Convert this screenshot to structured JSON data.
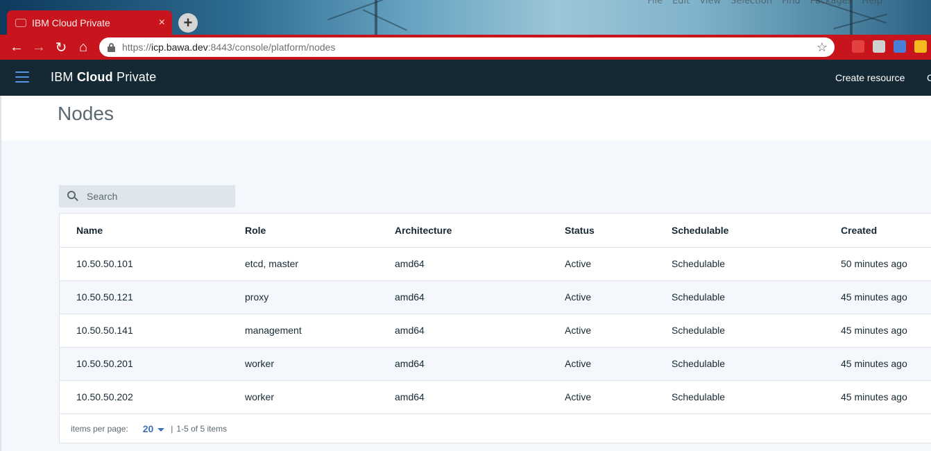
{
  "browser": {
    "desktop_menu": [
      "File",
      "Edit",
      "View",
      "Selection",
      "Find",
      "Packages",
      "Help"
    ],
    "tab": {
      "title": "IBM Cloud Private",
      "close": "×"
    },
    "new_tab": "+",
    "nav": {
      "back": "←",
      "forward": "→",
      "reload": "↻",
      "home": "⌂"
    },
    "address": {
      "scheme": "https://",
      "host": "icp.bawa.dev",
      "rest": ":8443/console/platform/nodes"
    },
    "star": "☆",
    "extensions": [
      {
        "name": "bookmark-extension-icon",
        "color": "#e34040"
      },
      {
        "name": "print-extension-icon",
        "color": "#d0d0d0"
      },
      {
        "name": "translate-extension-icon",
        "color": "#4a7fd6"
      },
      {
        "name": "drive-extension-icon",
        "color": "#f3b91e"
      }
    ]
  },
  "appbar": {
    "brand_prefix": "IBM ",
    "brand_bold": "Cloud",
    "brand_suffix": " Private",
    "create_resource": "Create resource",
    "truncated_link": "C"
  },
  "page": {
    "title": "Nodes",
    "search": {
      "placeholder": "Search",
      "value": ""
    },
    "table": {
      "columns": [
        "Name",
        "Role",
        "Architecture",
        "Status",
        "Schedulable",
        "Created"
      ],
      "rows": [
        [
          "10.50.50.101",
          "etcd, master",
          "amd64",
          "Active",
          "Schedulable",
          "50 minutes ago"
        ],
        [
          "10.50.50.121",
          "proxy",
          "amd64",
          "Active",
          "Schedulable",
          "45 minutes ago"
        ],
        [
          "10.50.50.141",
          "management",
          "amd64",
          "Active",
          "Schedulable",
          "45 minutes ago"
        ],
        [
          "10.50.50.201",
          "worker",
          "amd64",
          "Active",
          "Schedulable",
          "45 minutes ago"
        ],
        [
          "10.50.50.202",
          "worker",
          "amd64",
          "Active",
          "Schedulable",
          "45 minutes ago"
        ]
      ]
    },
    "pagination": {
      "items_per_page_label": "items per page:",
      "items_per_page_value": "20",
      "separator": "|",
      "range": "1-5 of 5 items"
    }
  },
  "colors": {
    "chrome_red": "#c8141c",
    "appbar": "#152935",
    "accent_blue": "#3d70b2"
  }
}
